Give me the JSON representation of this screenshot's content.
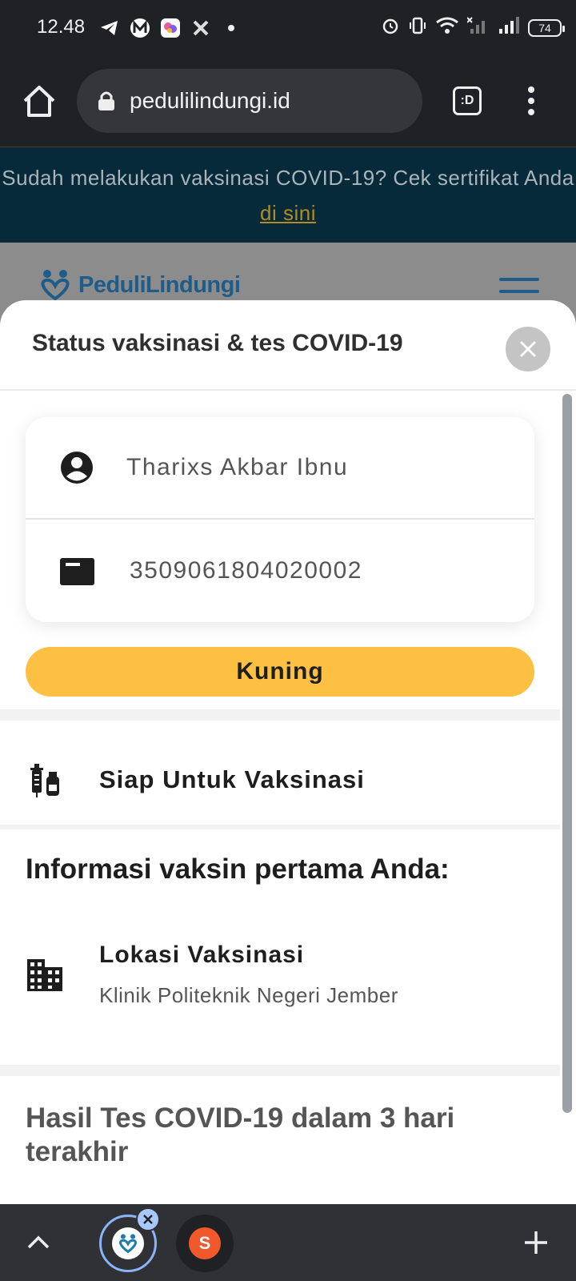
{
  "status_bar": {
    "time": "12.48",
    "battery": "74",
    "notification_icons": [
      "telegram-icon",
      "app-m-icon",
      "app-color-icon",
      "x-icon",
      "dot-icon"
    ],
    "system_icons": [
      "alarm-icon",
      "vibrate-icon",
      "wifi-icon",
      "signal-off-icon",
      "signal-icon",
      "battery-icon"
    ]
  },
  "browser": {
    "url": "pedulilindungi.id",
    "tabs_label": ":D"
  },
  "page": {
    "banner_text": "Sudah melakukan vaksinasi COVID-19? Cek sertifikat Anda ",
    "banner_link": "di sini",
    "brand_name": "PeduliLindungi"
  },
  "sheet": {
    "title": "Status vaksinasi & tes COVID-19",
    "user_name": "Tharixs Akbar Ibnu",
    "id_number": "3509061804020002",
    "status_label": "Kuning",
    "status_color": "#fdc043",
    "vaccination_status": "Siap Untuk Vaksinasi",
    "info_title": "Informasi vaksin pertama Anda:",
    "location_label": "Lokasi Vaksinasi",
    "location_value": "Klinik Politeknik Negeri Jember",
    "test_title": "Hasil Tes COVID-19 dalam 3 hari terakhir"
  },
  "bottom_bar": {
    "shopee_label": "S"
  }
}
